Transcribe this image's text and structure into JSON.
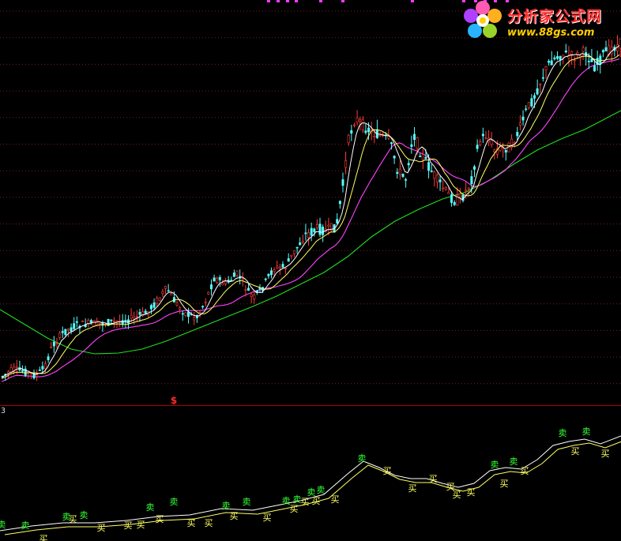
{
  "panel_number": "3",
  "watermark": {
    "name": "分析家公式网",
    "url": "www.88gs.com"
  },
  "colors": {
    "background": "#000000",
    "grid": "#7a1f1f",
    "up_candle": "#ff3b3b",
    "down_candle": "#54ffff",
    "ma_short": "#ffffff",
    "ma_mid": "#ffff66",
    "ma_long": "#ff44ff",
    "ma_longest": "#22dd22",
    "buy_label": "#ffff66",
    "sell_label": "#33ff33",
    "divider": "#b00000"
  },
  "signals": {
    "buy": "买",
    "sell": "卖"
  },
  "marker_symbol": "$",
  "icons": [
    "flower-logo-icon"
  ]
}
